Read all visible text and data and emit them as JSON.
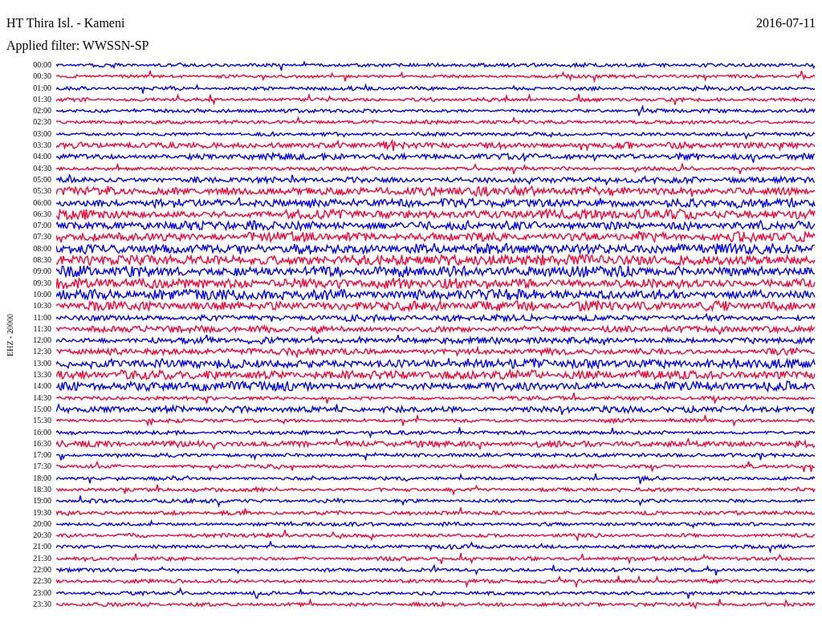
{
  "title": "HT Thira Isl. - Kameni",
  "date": "2016-07-11",
  "filter": "Applied filter: WWSSN-SP",
  "channel": "EHZ - 20000",
  "rows": [
    {
      "time": "00:00",
      "color": "#0000ff",
      "kind": "quiet"
    },
    {
      "time": "00:30",
      "color": "#ff0033",
      "kind": "quiet"
    },
    {
      "time": "01:00",
      "color": "#0000ff",
      "kind": "quiet"
    },
    {
      "time": "01:30",
      "color": "#ff0033",
      "kind": "quiet"
    },
    {
      "time": "02:00",
      "color": "#0000ff",
      "kind": "quiet"
    },
    {
      "time": "02:30",
      "color": "#ff0033",
      "kind": "quiet"
    },
    {
      "time": "03:00",
      "color": "#0000ff",
      "kind": "quiet"
    },
    {
      "time": "03:30",
      "color": "#ff0033",
      "kind": "noisy"
    },
    {
      "time": "04:00",
      "color": "#0000ff",
      "kind": "noisy"
    },
    {
      "time": "04:30",
      "color": "#ff0033",
      "kind": "quiet"
    },
    {
      "time": "05:00",
      "color": "#0000ff",
      "kind": "noisy"
    },
    {
      "time": "05:30",
      "color": "#ff0033",
      "kind": "heavy"
    },
    {
      "time": "06:00",
      "color": "#0000ff",
      "kind": "heavy"
    },
    {
      "time": "06:30",
      "color": "#ff0033",
      "kind": "heavy"
    },
    {
      "time": "07:00",
      "color": "#0000ff",
      "kind": "heavy"
    },
    {
      "time": "07:30",
      "color": "#ff0033",
      "kind": "heavy"
    },
    {
      "time": "08:00",
      "color": "#0000ff",
      "kind": "saturated"
    },
    {
      "time": "08:30",
      "color": "#ff0033",
      "kind": "saturated"
    },
    {
      "time": "09:00",
      "color": "#0000ff",
      "kind": "saturated"
    },
    {
      "time": "09:30",
      "color": "#ff0033",
      "kind": "saturated"
    },
    {
      "time": "10:00",
      "color": "#0000ff",
      "kind": "saturated"
    },
    {
      "time": "10:30",
      "color": "#ff0033",
      "kind": "heavy"
    },
    {
      "time": "11:00",
      "color": "#0000ff",
      "kind": "noisy"
    },
    {
      "time": "11:30",
      "color": "#ff0033",
      "kind": "noisy"
    },
    {
      "time": "12:00",
      "color": "#0000ff",
      "kind": "noisy"
    },
    {
      "time": "12:30",
      "color": "#ff0033",
      "kind": "noisy"
    },
    {
      "time": "13:00",
      "color": "#0000ff",
      "kind": "heavy"
    },
    {
      "time": "13:30",
      "color": "#ff0033",
      "kind": "heavy"
    },
    {
      "time": "14:00",
      "color": "#0000ff",
      "kind": "heavy"
    },
    {
      "time": "14:30",
      "color": "#ff0033",
      "kind": "quiet"
    },
    {
      "time": "15:00",
      "color": "#0000ff",
      "kind": "noisy"
    },
    {
      "time": "15:30",
      "color": "#ff0033",
      "kind": "quiet"
    },
    {
      "time": "16:00",
      "color": "#0000ff",
      "kind": "quiet"
    },
    {
      "time": "16:30",
      "color": "#ff0033",
      "kind": "noisy"
    },
    {
      "time": "17:00",
      "color": "#0000ff",
      "kind": "quiet"
    },
    {
      "time": "17:30",
      "color": "#ff0033",
      "kind": "quiet"
    },
    {
      "time": "18:00",
      "color": "#0000ff",
      "kind": "quiet"
    },
    {
      "time": "18:30",
      "color": "#ff0033",
      "kind": "quiet"
    },
    {
      "time": "19:00",
      "color": "#0000ff",
      "kind": "quiet"
    },
    {
      "time": "19:30",
      "color": "#ff0033",
      "kind": "quiet"
    },
    {
      "time": "20:00",
      "color": "#0000ff",
      "kind": "quiet"
    },
    {
      "time": "20:30",
      "color": "#ff0033",
      "kind": "quiet"
    },
    {
      "time": "21:00",
      "color": "#0000ff",
      "kind": "quiet"
    },
    {
      "time": "21:30",
      "color": "#ff0033",
      "kind": "quiet"
    },
    {
      "time": "22:00",
      "color": "#0000ff",
      "kind": "quiet"
    },
    {
      "time": "22:30",
      "color": "#ff0033",
      "kind": "quiet"
    },
    {
      "time": "23:00",
      "color": "#0000ff",
      "kind": "quiet"
    },
    {
      "time": "23:30",
      "color": "#ff0033",
      "kind": "quiet"
    }
  ]
}
